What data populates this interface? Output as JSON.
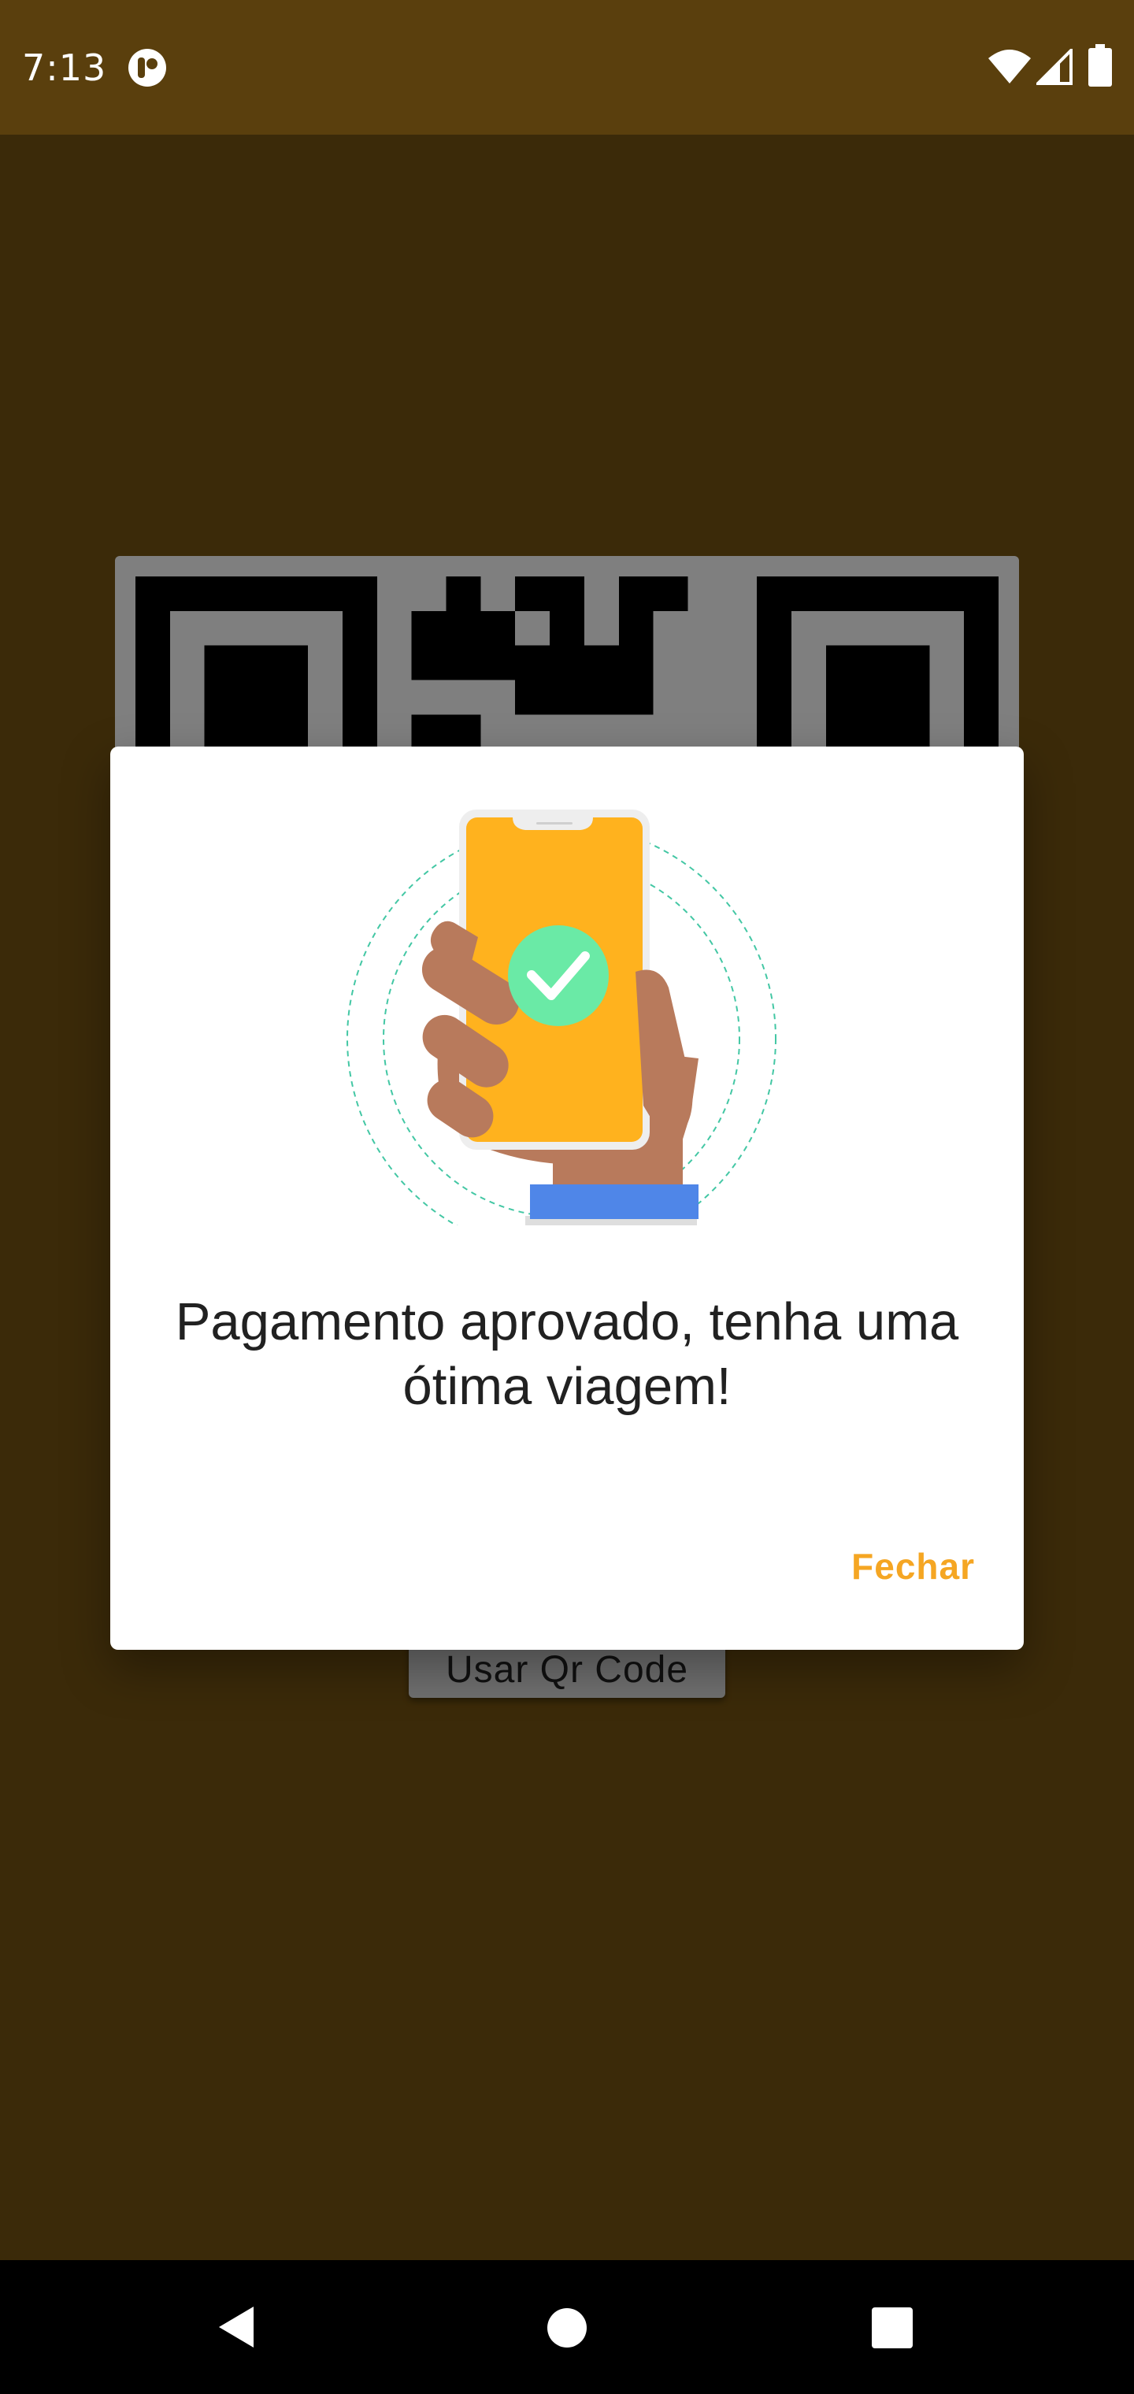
{
  "status_bar": {
    "time": "7:13",
    "icons": [
      "app-notification-icon",
      "wifi-icon",
      "signal-icon",
      "battery-icon"
    ]
  },
  "background_screen": {
    "qr_code": "qr-code-image",
    "use_qr_button_label": "Usar Qr Code"
  },
  "dialog": {
    "illustration": "phone-approved-illustration",
    "message": "Pagamento aprovado, tenha uma ótima viagem!",
    "close_label": "Fechar"
  },
  "nav_bar": {
    "icons": [
      "back-icon",
      "home-icon",
      "recents-icon"
    ]
  },
  "colors": {
    "background": "#775412",
    "status_bar": "#5a3f0d",
    "accent": "#f5a623",
    "phone_screen": "#ffb21e",
    "check": "#6aeaa6",
    "sleeve": "#4f86e8",
    "skin": "#b87a5c"
  }
}
